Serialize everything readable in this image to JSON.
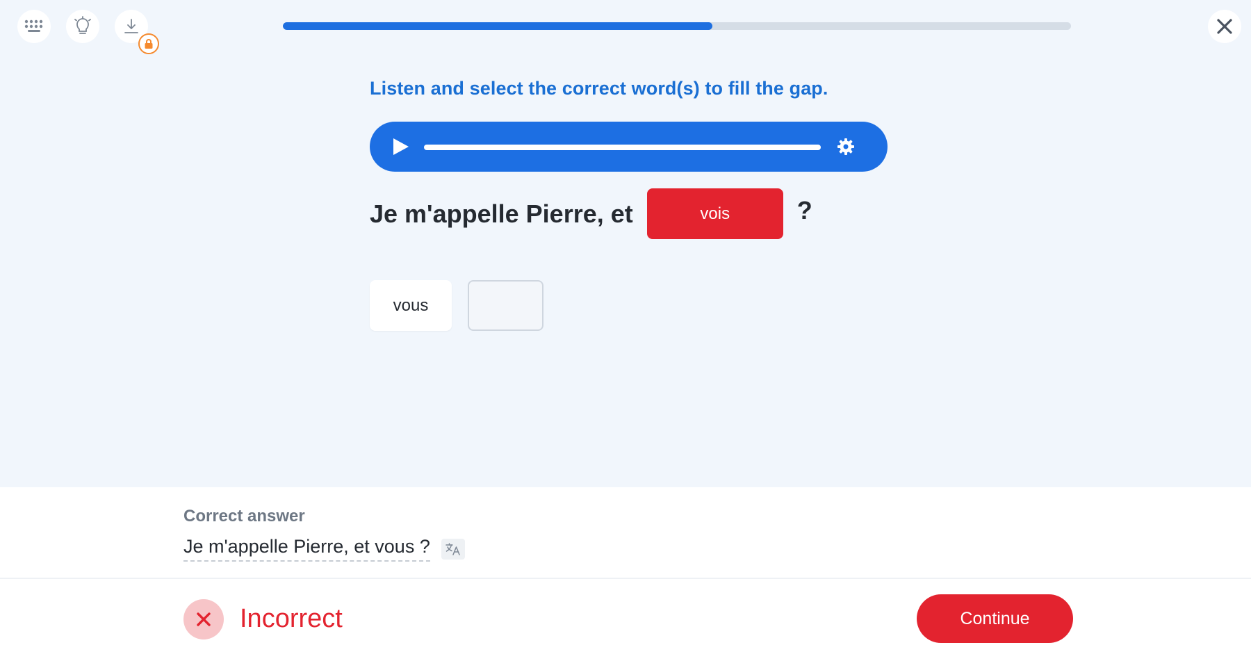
{
  "progress": {
    "percent": 54.5
  },
  "top_icons": [
    "keypad-icon",
    "lightbulb-icon",
    "download-icon",
    "lock-icon"
  ],
  "instruction": "Listen and select the correct word(s) to fill the gap.",
  "audio": {
    "play_icon": "play-icon",
    "settings_icon": "gear-icon"
  },
  "sentence": {
    "prefix": "Je m'appelle Pierre, et",
    "selected_answer": "vois",
    "suffix": "?"
  },
  "options": [
    {
      "label": "vous"
    },
    {
      "label": ""
    }
  ],
  "feedback": {
    "correct_label": "Correct answer",
    "correct_text": "Je m'appelle Pierre, et vous ?",
    "translate_icon": "translate-icon",
    "result": "Incorrect",
    "continue_label": "Continue"
  },
  "colors": {
    "accent_blue": "#1e6fe0",
    "error_red": "#e3232f",
    "lock_orange": "#f58a2e",
    "background": "#f1f6fc"
  }
}
